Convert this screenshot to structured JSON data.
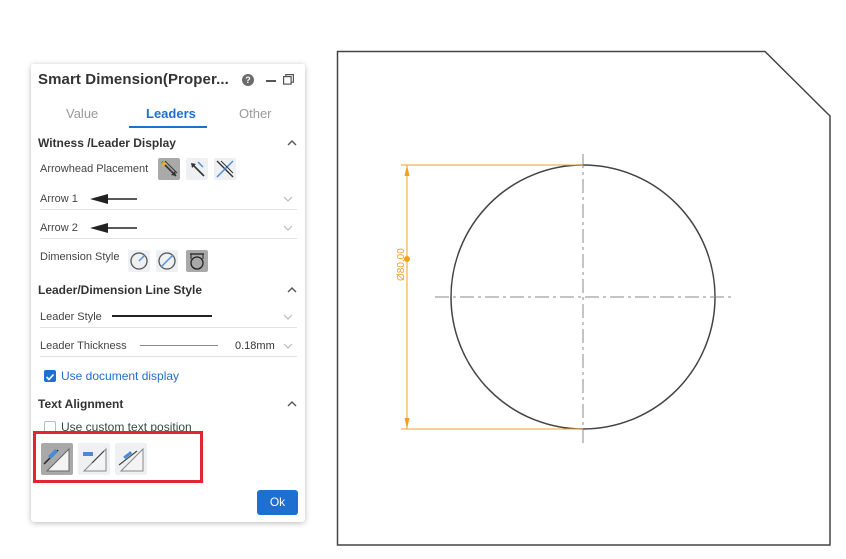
{
  "dialog": {
    "title": "Smart Dimension(Proper...",
    "help_glyph": "?",
    "tabs": [
      {
        "label": "Value"
      },
      {
        "label": "Leaders"
      },
      {
        "label": "Other"
      }
    ],
    "active_tab": "Leaders",
    "sections": {
      "witness": {
        "title": "Witness /Leader Display",
        "arrowhead_placement_label": "Arrowhead Placement",
        "arrow1_label": "Arrow 1",
        "arrow2_label": "Arrow 2",
        "dimension_style_label": "Dimension Style"
      },
      "leader_line": {
        "title": "Leader/Dimension Line Style",
        "leader_style_label": "Leader Style",
        "leader_thickness_label": "Leader Thickness",
        "leader_thickness_value": "0.18mm",
        "use_document_display_label": "Use document display",
        "use_document_display_checked": true
      },
      "text_alignment": {
        "title": "Text Alignment",
        "use_custom_text_position_label": "Use custom text position",
        "use_custom_text_position_checked": false
      }
    },
    "ok_label": "Ok"
  },
  "drawing": {
    "dimension_text": "Ø80.00"
  },
  "colors": {
    "accent": "#1f6fd1",
    "highlight": "#e0262e",
    "dimension": "#f0a020",
    "geometry": "#444444"
  },
  "icons": {
    "arrowhead_placement": [
      "arrowhead-outside-icon",
      "arrowhead-inside-icon",
      "arrowhead-smart-icon"
    ],
    "dimension_style": [
      "radius-style-icon",
      "diameter-style-icon",
      "linear-diameter-style-icon"
    ],
    "text_alignment": [
      "text-aligned-icon",
      "text-horizontal-icon",
      "text-parallel-icon"
    ]
  }
}
